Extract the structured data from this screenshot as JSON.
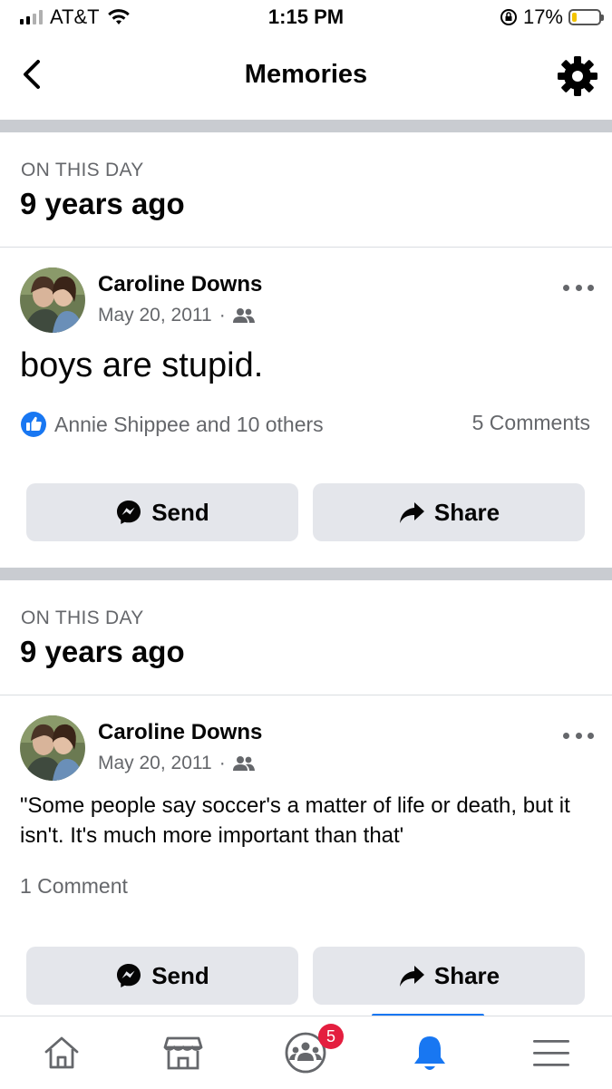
{
  "status_bar": {
    "carrier": "AT&T",
    "time": "1:15 PM",
    "battery": "17%",
    "battery_level": 0.17
  },
  "nav": {
    "title": "Memories"
  },
  "memories": [
    {
      "label": "ON THIS DAY",
      "ago": "9 years ago",
      "post": {
        "author": "Caroline Downs",
        "date": "May 20, 2011",
        "separator": "·",
        "text": "boys are stupid.",
        "reactions": "Annie Shippee and 10 others",
        "comments": "5 Comments"
      },
      "send_label": "Send",
      "share_label": "Share"
    },
    {
      "label": "ON THIS DAY",
      "ago": "9 years ago",
      "post": {
        "author": "Caroline Downs",
        "date": "May 20, 2011",
        "separator": "·",
        "text": "\"Some people say soccer's a matter of life or death, but it isn't.  It's much more important than that'",
        "comments": "1 Comment"
      },
      "send_label": "Send",
      "share_label": "Share"
    }
  ],
  "tabbar": {
    "items": [
      {
        "icon": "home-icon"
      },
      {
        "icon": "marketplace-icon"
      },
      {
        "icon": "groups-icon",
        "badge": "5"
      },
      {
        "icon": "notifications-bell-icon",
        "active": true
      },
      {
        "icon": "menu-icon"
      }
    ]
  },
  "colors": {
    "accent": "#1877f2",
    "badge": "#e41e3f",
    "button_bg": "#e4e6eb",
    "secondary_text": "#65676b"
  }
}
